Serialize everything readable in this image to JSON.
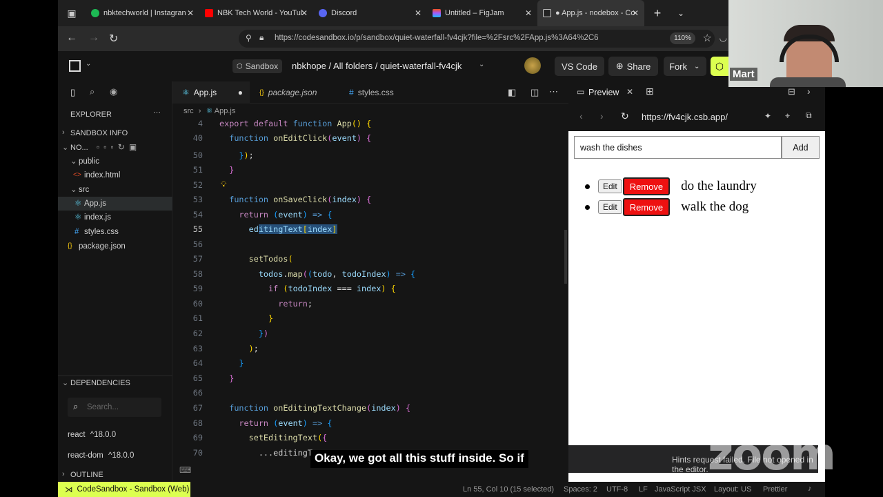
{
  "browser": {
    "tabs": [
      {
        "label": "nbktechworld | Instagran",
        "favicon_color": "#1db954"
      },
      {
        "label": "NBK Tech World - YouTul",
        "favicon_color": "#ff0000"
      },
      {
        "label": "Discord",
        "favicon_color": "#5865f2"
      },
      {
        "label": "Untitled – FigJam",
        "favicon_color": "#a259ff"
      },
      {
        "label": "● App.js - nodebox - Co",
        "favicon_color": "#222222"
      }
    ],
    "url": "https://codesandbox.io/p/sandbox/quiet-waterfall-fv4cjk?file=%2Fsrc%2FApp.js%3A64%2C6",
    "zoom": "110%"
  },
  "header": {
    "sandbox_badge": "Sandbox",
    "path": "nbkhope / All folders / quiet-waterfall-fv4cjk",
    "vscode_label": "VS Code",
    "share_label": "Share",
    "fork_label": "Fork"
  },
  "sidebar": {
    "explorer_label": "EXPLORER",
    "sandbox_info_label": "SANDBOX INFO",
    "project_label": "NO...",
    "tree": [
      {
        "label": "public",
        "kind": "folder"
      },
      {
        "label": "index.html",
        "kind": "file"
      },
      {
        "label": "src",
        "kind": "folder"
      },
      {
        "label": "App.js",
        "kind": "file"
      },
      {
        "label": "index.js",
        "kind": "file"
      },
      {
        "label": "styles.css",
        "kind": "file"
      },
      {
        "label": "package.json",
        "kind": "file"
      }
    ],
    "dependencies_label": "DEPENDENCIES",
    "search_placeholder": "Search...",
    "dependencies": [
      {
        "name": "react",
        "version": "^18.0.0"
      },
      {
        "name": "react-dom",
        "version": "^18.0.0"
      }
    ],
    "outline_label": "OUTLINE"
  },
  "editor": {
    "tabs": [
      "App.js",
      "package.json",
      "styles.css"
    ],
    "breadcrumb_folder": "src",
    "breadcrumb_file": "App.js",
    "lines": [
      {
        "n": "4",
        "text": "export default function App() {"
      },
      {
        "n": "40",
        "text": "  function onEditClick(event) {"
      },
      {
        "n": "50",
        "text": "    });"
      },
      {
        "n": "51",
        "text": "  }"
      },
      {
        "n": "52",
        "text": ""
      },
      {
        "n": "53",
        "text": "  function onSaveClick(index) {"
      },
      {
        "n": "54",
        "text": "    return (event) => {"
      },
      {
        "n": "55",
        "text": "      editingText[index]"
      },
      {
        "n": "56",
        "text": ""
      },
      {
        "n": "57",
        "text": "      setTodos("
      },
      {
        "n": "58",
        "text": "        todos.map((todo, todoIndex) => {"
      },
      {
        "n": "59",
        "text": "          if (todoIndex === index) {"
      },
      {
        "n": "60",
        "text": "            return;"
      },
      {
        "n": "61",
        "text": "          }"
      },
      {
        "n": "62",
        "text": "        })"
      },
      {
        "n": "63",
        "text": "      );"
      },
      {
        "n": "64",
        "text": "    }"
      },
      {
        "n": "65",
        "text": "  }"
      },
      {
        "n": "66",
        "text": ""
      },
      {
        "n": "67",
        "text": "  function onEditingTextChange(index) {"
      },
      {
        "n": "68",
        "text": "    return (event) => {"
      },
      {
        "n": "69",
        "text": "      setEditingText({"
      },
      {
        "n": "70",
        "text": "        ...editingT"
      }
    ]
  },
  "preview": {
    "title": "Preview",
    "url": "https://fv4cjk.csb.app/",
    "input_value": "wash the dishes",
    "add_label": "Add",
    "edit_label": "Edit",
    "remove_label": "Remove",
    "todos": [
      "do the laundry",
      "walk the dog"
    ],
    "notification": "Hints request failed. File not opened in the editor."
  },
  "statusbar": {
    "csb_label": "CodeSandbox - Sandbox (Web)",
    "position": "Ln 55, Col 10 (15 selected)",
    "spaces": "Spaces: 2",
    "encoding": "UTF-8",
    "eol": "LF",
    "language": "JavaScript JSX",
    "layout": "Layout: US",
    "formatter": "Prettier"
  },
  "webcam": {
    "name": "Mart"
  },
  "caption": "Okay, we got all this stuff inside. So if",
  "watermark": "zoom"
}
